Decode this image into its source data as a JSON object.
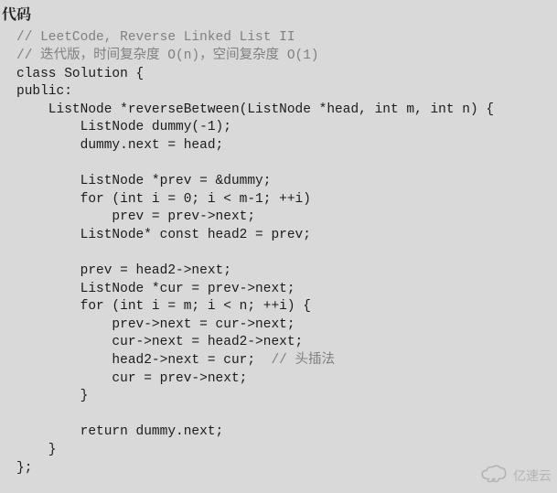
{
  "heading": "代码",
  "code": {
    "c1_prefix": "// ",
    "c1_body": "LeetCode, Reverse Linked List II",
    "c2_prefix": "// ",
    "c2_body": "迭代版，时间复杂度 O(n)，空间复杂度 O(1)",
    "l3": "class Solution {",
    "l4": "public:",
    "l5": "    ListNode *reverseBetween(ListNode *head, int m, int n) {",
    "l6": "        ListNode dummy(-1);",
    "l7": "        dummy.next = head;",
    "l8": "",
    "l9": "        ListNode *prev = &dummy;",
    "l10": "        for (int i = 0; i < m-1; ++i)",
    "l11": "            prev = prev->next;",
    "l12": "        ListNode* const head2 = prev;",
    "l13": "",
    "l14": "        prev = head2->next;",
    "l15": "        ListNode *cur = prev->next;",
    "l16": "        for (int i = m; i < n; ++i) {",
    "l17": "            prev->next = cur->next;",
    "l18": "            cur->next = head2->next;",
    "l19a": "            head2->next = cur;  ",
    "l19b_prefix": "// ",
    "l19b_body": "头插法",
    "l20": "            cur = prev->next;",
    "l21": "        }",
    "l22": "",
    "l23": "        return dummy.next;",
    "l24": "    }",
    "l25": "};"
  },
  "watermark_text": "亿速云"
}
